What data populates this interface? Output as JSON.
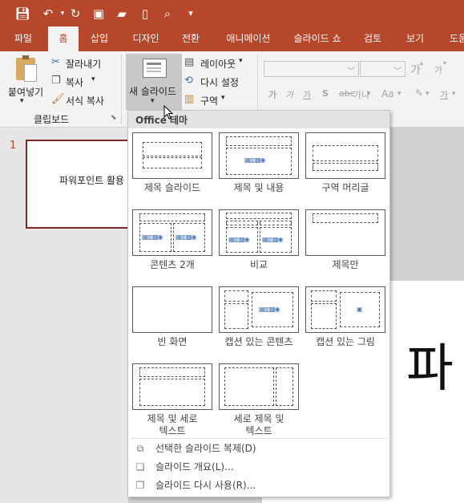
{
  "colors": {
    "accent": "#b7472a",
    "ribbon": "#f3f3f3"
  },
  "qat": {
    "icons": [
      "save-icon",
      "undo-icon",
      "redo-icon",
      "present-icon",
      "open-icon",
      "new-icon",
      "print-preview-icon",
      "customize-icon"
    ]
  },
  "tabs": [
    "파일",
    "홈",
    "삽입",
    "디자인",
    "전환",
    "애니메이션",
    "슬라이드 쇼",
    "검토",
    "보기",
    "도움"
  ],
  "active_tab": "홈",
  "clipboard": {
    "paste": "붙여넣기",
    "cut": "잘라내기",
    "copy": "복사",
    "format_painter": "서식 복사",
    "group": "클립보드"
  },
  "slides": {
    "new_slide": "새 슬라이드",
    "layout": "레이아웃",
    "reset": "다시 설정",
    "section": "구역"
  },
  "font": {
    "bold": "가",
    "italic": "가",
    "underline": "가",
    "strike": "S",
    "spacing": "가나",
    "case": "Aa",
    "grow": "가",
    "shrink": "가",
    "color": "가"
  },
  "thumbnail": {
    "number": "1",
    "text": "파워포인트 활용"
  },
  "canvas": {
    "big_text": "파"
  },
  "dropdown": {
    "header": "Office 테마",
    "layouts": [
      {
        "label": "제목 슬라이드"
      },
      {
        "label": "제목 및 내용"
      },
      {
        "label": "구역 머리글"
      },
      {
        "label": "콘텐츠 2개"
      },
      {
        "label": "비교"
      },
      {
        "label": "제목만"
      },
      {
        "label": "빈 화면"
      },
      {
        "label": "캡션 있는 콘텐츠"
      },
      {
        "label": "캡션 있는 그림"
      },
      {
        "label_line1": "제목 및 세로",
        "label_line2": "텍스트"
      },
      {
        "label_line1": "세로 제목 및",
        "label_line2": "텍스트"
      }
    ],
    "menu": [
      {
        "label": "선택한 슬라이드 복제(D)",
        "icon": "duplicate-slide-icon"
      },
      {
        "label": "슬라이드 개요(L)...",
        "icon": "outline-icon"
      },
      {
        "label": "슬라이드 다시 사용(R)...",
        "icon": "reuse-slides-icon"
      }
    ]
  }
}
